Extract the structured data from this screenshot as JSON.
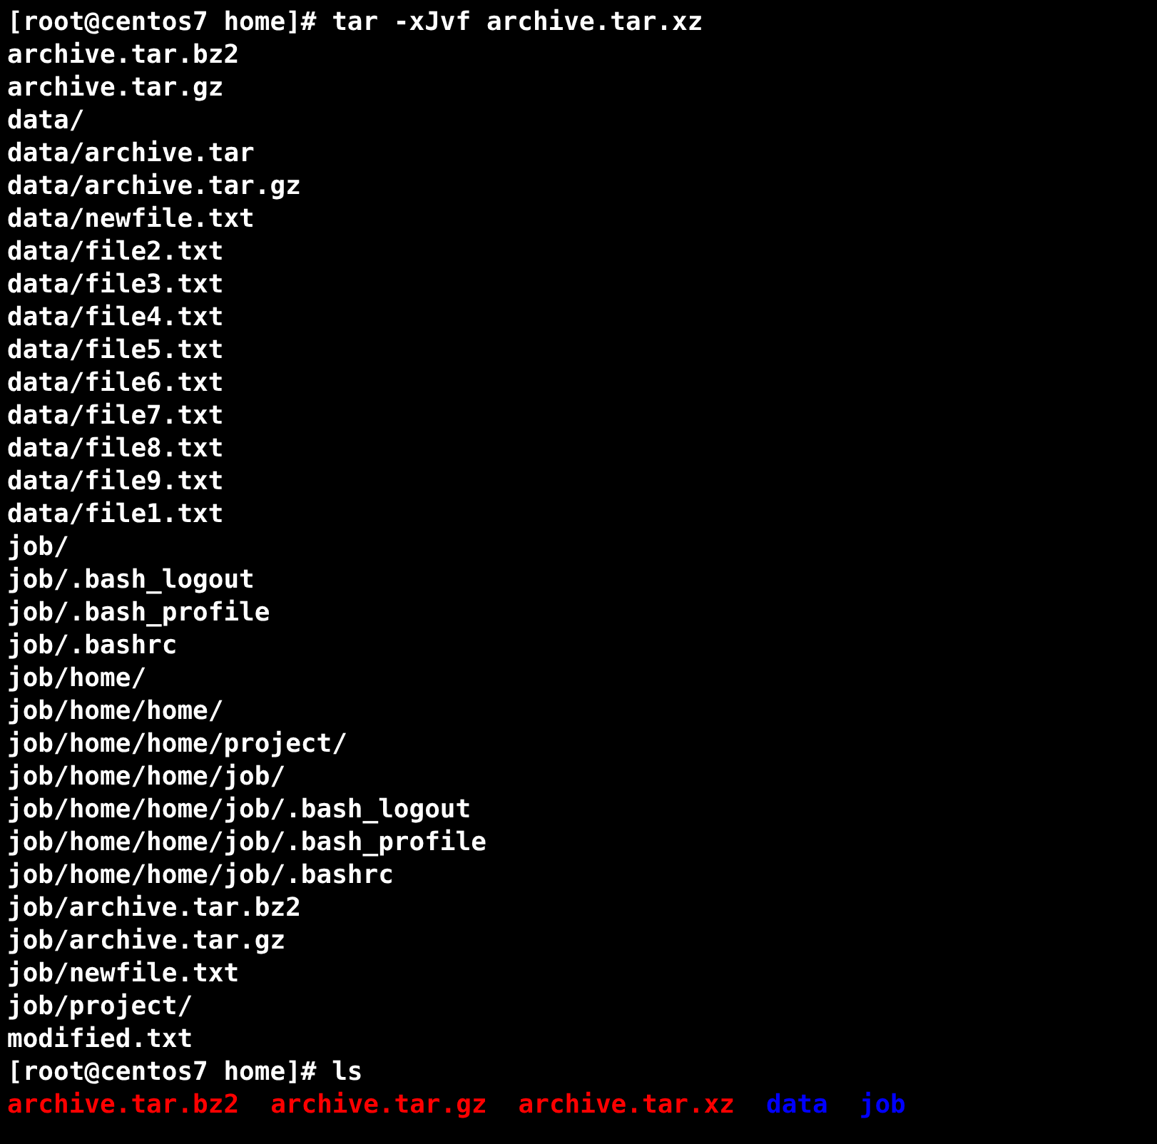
{
  "terminal": {
    "lines": [
      "[root@centos7 home]# tar -xJvf archive.tar.xz",
      "archive.tar.bz2",
      "archive.tar.gz",
      "data/",
      "data/archive.tar",
      "data/archive.tar.gz",
      "data/newfile.txt",
      "data/file2.txt",
      "data/file3.txt",
      "data/file4.txt",
      "data/file5.txt",
      "data/file6.txt",
      "data/file7.txt",
      "data/file8.txt",
      "data/file9.txt",
      "data/file1.txt",
      "job/",
      "job/.bash_logout",
      "job/.bash_profile",
      "job/.bashrc",
      "job/home/",
      "job/home/home/",
      "job/home/home/project/",
      "job/home/home/job/",
      "job/home/home/job/.bash_logout",
      "job/home/home/job/.bash_profile",
      "job/home/home/job/.bashrc",
      "job/archive.tar.bz2",
      "job/archive.tar.gz",
      "job/newfile.txt",
      "job/project/",
      "modified.txt",
      "[root@centos7 home]# ls"
    ],
    "listing": [
      {
        "kind": "archive",
        "name": "archive.tar.bz2"
      },
      {
        "kind": "archive",
        "name": "archive.tar.gz"
      },
      {
        "kind": "archive",
        "name": "archive.tar.xz"
      },
      {
        "kind": "directory",
        "name": "data"
      },
      {
        "kind": "directory",
        "name": "job"
      }
    ]
  }
}
